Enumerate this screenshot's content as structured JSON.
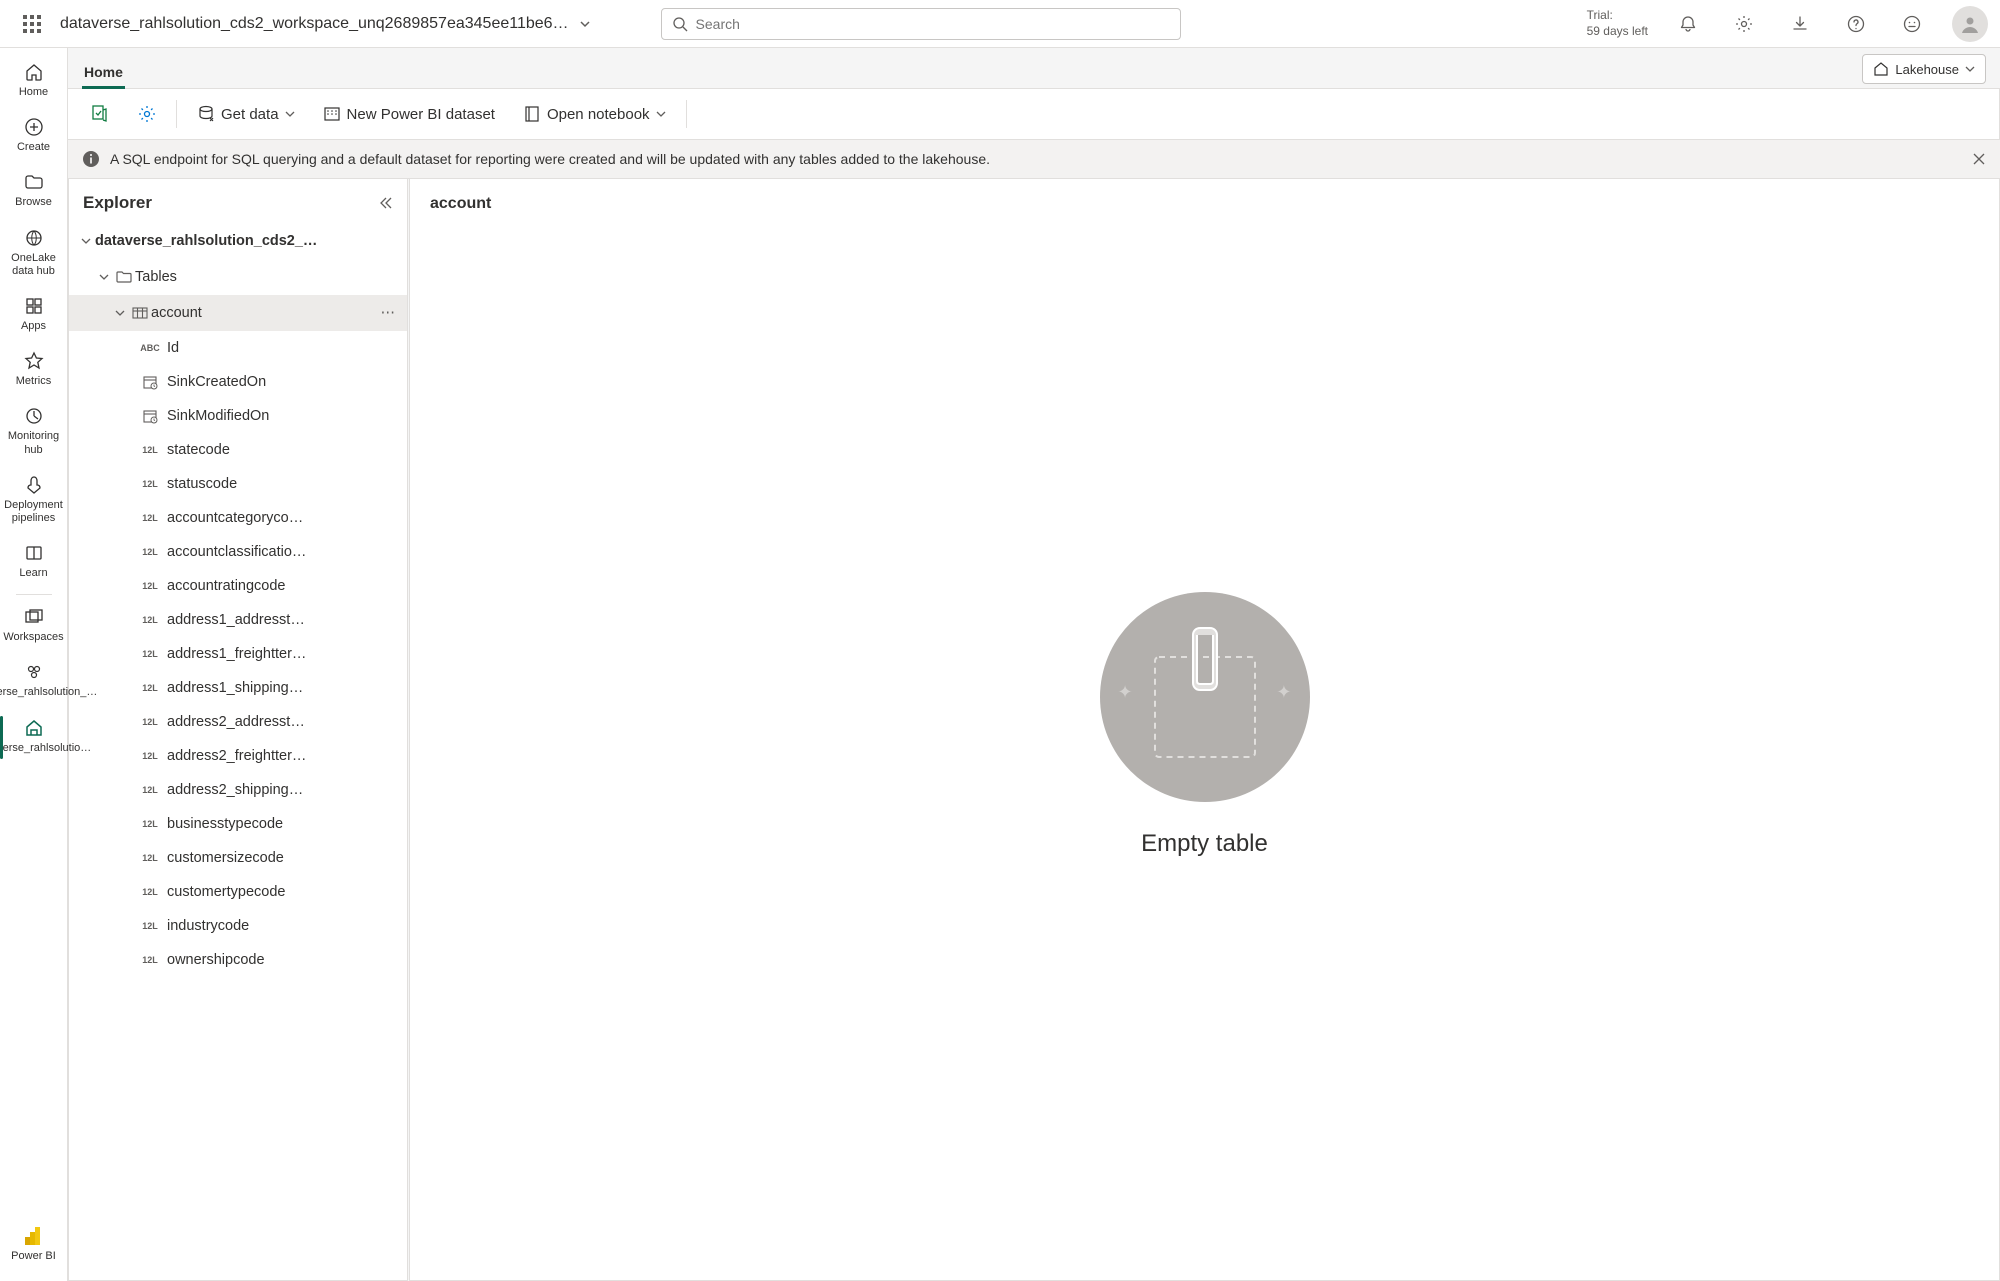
{
  "header": {
    "breadcrumb": "dataverse_rahlsolution_cds2_workspace_unq2689857ea345ee11be6…",
    "search_placeholder": "Search",
    "trial_label": "Trial:",
    "trial_remaining": "59 days left"
  },
  "rail": {
    "items": [
      {
        "id": "home",
        "label": "Home"
      },
      {
        "id": "create",
        "label": "Create"
      },
      {
        "id": "browse",
        "label": "Browse"
      },
      {
        "id": "onelake",
        "label": "OneLake data hub"
      },
      {
        "id": "apps",
        "label": "Apps"
      },
      {
        "id": "metrics",
        "label": "Metrics"
      },
      {
        "id": "monitoring",
        "label": "Monitoring hub"
      },
      {
        "id": "deployment",
        "label": "Deployment pipelines"
      },
      {
        "id": "learn",
        "label": "Learn"
      },
      {
        "id": "workspaces",
        "label": "Workspaces"
      },
      {
        "id": "ws1",
        "label": "dataverse_rahlsolution_…"
      },
      {
        "id": "ws2",
        "label": "dataverse_rahlsolutio…"
      }
    ],
    "bottom": "Power BI"
  },
  "tabs": {
    "active": "Home",
    "lakehouse_chip": "Lakehouse"
  },
  "toolbar": {
    "get_data": "Get data",
    "new_dataset": "New Power BI dataset",
    "open_notebook": "Open notebook"
  },
  "banner": {
    "text": "A SQL endpoint for SQL querying and a default dataset for reporting were created and will be updated with any tables added to the lakehouse."
  },
  "explorer": {
    "title": "Explorer",
    "root": "dataverse_rahlsolution_cds2_…",
    "tables_label": "Tables",
    "selected_table": "account",
    "columns": [
      {
        "type": "ABC",
        "name": "Id"
      },
      {
        "type": "DT",
        "name": "SinkCreatedOn"
      },
      {
        "type": "DT",
        "name": "SinkModifiedOn"
      },
      {
        "type": "12L",
        "name": "statecode"
      },
      {
        "type": "12L",
        "name": "statuscode"
      },
      {
        "type": "12L",
        "name": "accountcategoryco…"
      },
      {
        "type": "12L",
        "name": "accountclassificatio…"
      },
      {
        "type": "12L",
        "name": "accountratingcode"
      },
      {
        "type": "12L",
        "name": "address1_addresst…"
      },
      {
        "type": "12L",
        "name": "address1_freightter…"
      },
      {
        "type": "12L",
        "name": "address1_shipping…"
      },
      {
        "type": "12L",
        "name": "address2_addresst…"
      },
      {
        "type": "12L",
        "name": "address2_freightter…"
      },
      {
        "type": "12L",
        "name": "address2_shipping…"
      },
      {
        "type": "12L",
        "name": "businesstypecode"
      },
      {
        "type": "12L",
        "name": "customersizecode"
      },
      {
        "type": "12L",
        "name": "customertypecode"
      },
      {
        "type": "12L",
        "name": "industrycode"
      },
      {
        "type": "12L",
        "name": "ownershipcode"
      }
    ]
  },
  "detail": {
    "title": "account",
    "empty_label": "Empty table"
  }
}
